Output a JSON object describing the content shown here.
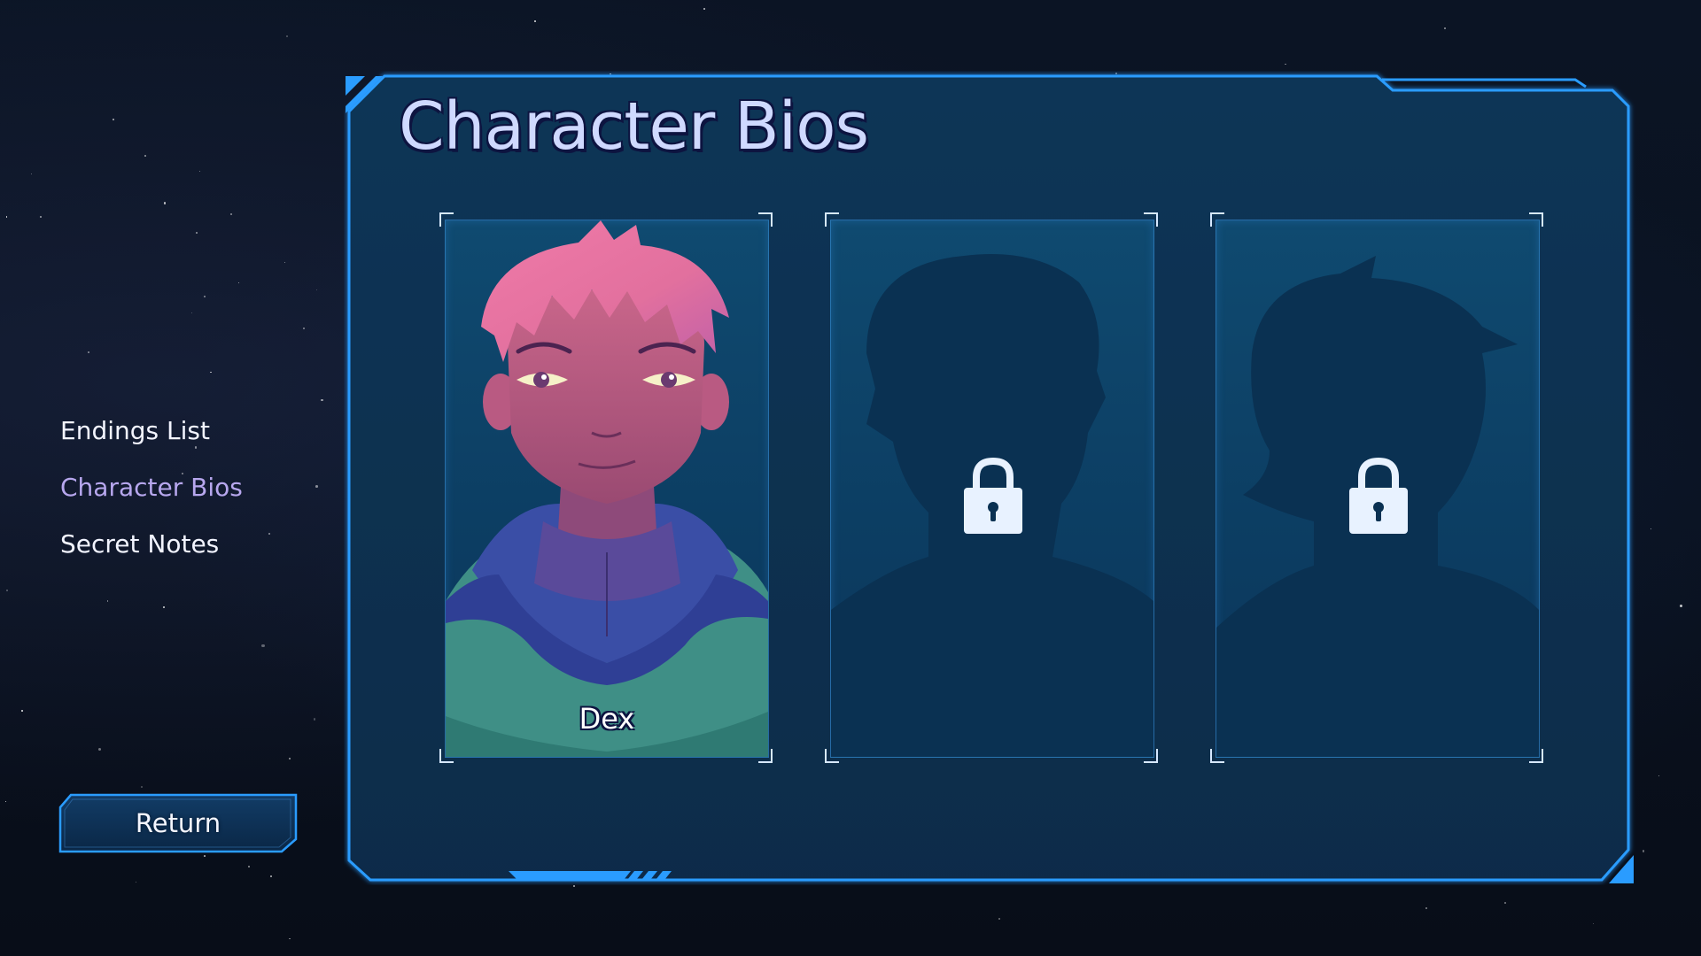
{
  "menu": {
    "items": [
      {
        "label": "Endings List",
        "active": false
      },
      {
        "label": "Character Bios",
        "active": true
      },
      {
        "label": "Secret Notes",
        "active": false
      }
    ]
  },
  "return_button": {
    "label": "Return"
  },
  "panel": {
    "title": "Character Bios",
    "cards": [
      {
        "name": "Dex",
        "locked": false,
        "icon": "portrait-dex"
      },
      {
        "name": "",
        "locked": true,
        "icon": "lock-icon"
      },
      {
        "name": "",
        "locked": true,
        "icon": "lock-icon"
      }
    ]
  },
  "colors": {
    "accent": "#2a9cff",
    "active_menu": "#b7a7ee",
    "panel_bg": "#0b3150",
    "title": "#cfd9ff"
  }
}
